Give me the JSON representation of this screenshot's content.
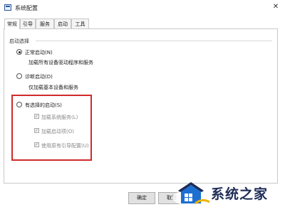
{
  "window": {
    "title": "系统配置",
    "close_glyph": "✕"
  },
  "tabs": [
    {
      "label": "常规",
      "active": true
    },
    {
      "label": "引导",
      "active": false
    },
    {
      "label": "服务",
      "active": false
    },
    {
      "label": "启动",
      "active": false
    },
    {
      "label": "工具",
      "active": false
    }
  ],
  "startup": {
    "group_label": "启动选择",
    "normal": {
      "label": "正常启动(N)",
      "desc": "加载所有设备驱动程序和服务",
      "selected": true
    },
    "diagnostic": {
      "label": "诊断启动(D)",
      "desc": "仅加载基本设备和服务",
      "selected": false
    },
    "selective": {
      "label": "有选择的启动(S)",
      "selected": false,
      "options": [
        {
          "label": "加载系统服务(L)",
          "checked": true
        },
        {
          "label": "加载启动项(O)",
          "checked": true
        },
        {
          "label": "使用原有引导配置(U)",
          "checked": true
        }
      ]
    }
  },
  "buttons": {
    "ok": "确定",
    "cancel": "取消"
  },
  "watermark": {
    "text": "系统之家"
  },
  "colors": {
    "highlight": "#d22a2a",
    "watermark_blue": "#1d2b56"
  }
}
